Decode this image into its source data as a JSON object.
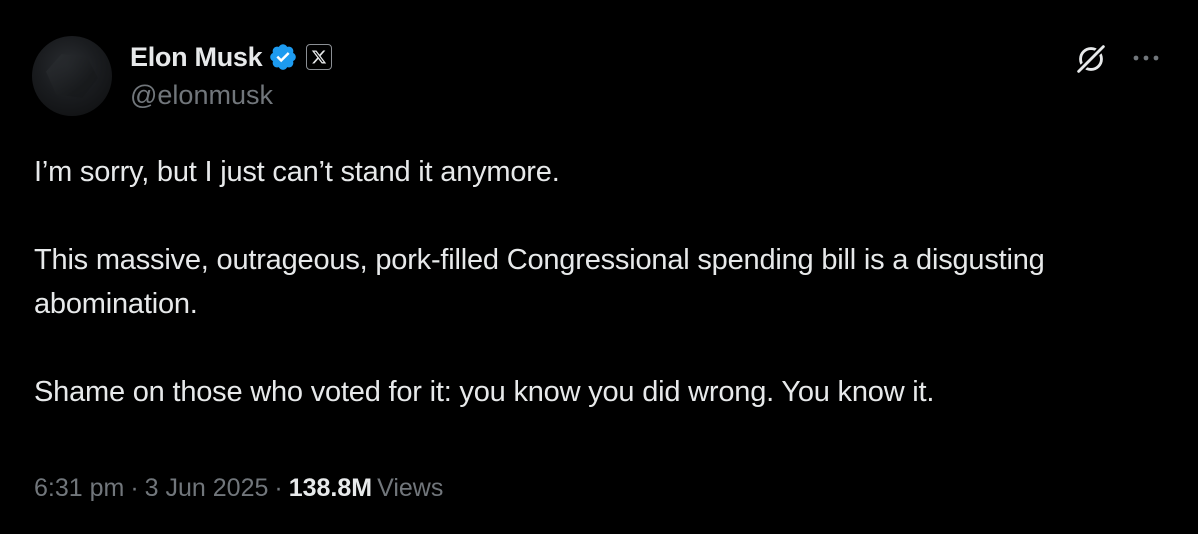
{
  "tweet": {
    "author": {
      "display_name": "Elon Musk",
      "handle": "@elonmusk",
      "verified": true,
      "affiliate_badge_icon": "x-logo-icon",
      "avatar_icon": "avatar"
    },
    "header_actions": {
      "grok_icon": "grok-icon",
      "more_icon": "more-icon"
    },
    "body": {
      "paragraphs": [
        "I’m sorry, but I just can’t stand it anymore.",
        "This massive, outrageous, pork-filled Congressional spending bill is a disgusting abomination.",
        "Shame on those who voted for it: you know you did wrong. You know it."
      ]
    },
    "meta": {
      "time": "6:31 pm",
      "separator": "·",
      "date": "3 Jun 2025",
      "views_count": "138.8M",
      "views_label": "Views"
    }
  },
  "colors": {
    "background": "#000000",
    "primary_text": "#e7e9ea",
    "secondary_text": "#71767b",
    "verified_blue": "#1d9bf0"
  }
}
